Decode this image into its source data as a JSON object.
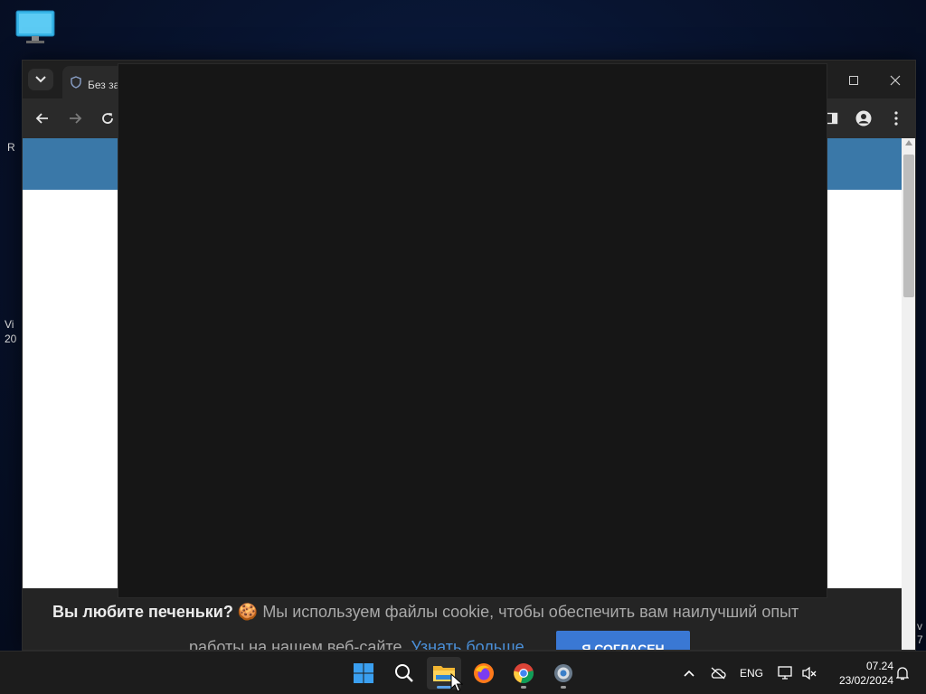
{
  "desktop": {
    "edge_texts": [
      "R",
      "Vi",
      "20",
      "v",
      "7"
    ]
  },
  "browser": {
    "tab": {
      "title": "Без за"
    },
    "window_controls": [
      "minimize",
      "maximize",
      "close"
    ]
  },
  "cookie_banner": {
    "bold_text": "Вы любите печеньки?",
    "emoji": "🍪",
    "message_line1": "Мы используем файлы cookie, чтобы обеспечить вам наилучший опыт",
    "message_line2": "работы на нашем веб-сайте.",
    "learn_more": "Узнать больше",
    "accept": "Я СОГЛАСЕН"
  },
  "taskbar": {
    "apps": [
      "start-icon",
      "search-icon",
      "file-explorer-icon",
      "firefox-icon",
      "chrome-icon",
      "settings-icon"
    ],
    "language": "ENG",
    "time": "07.24",
    "date": "23/02/2024"
  },
  "colors": {
    "site_header": "#3a78a8",
    "accept_button": "#3a78d4",
    "link": "#4a8fd8",
    "overlay": "#161616",
    "taskbar": "#1c1c1c"
  }
}
